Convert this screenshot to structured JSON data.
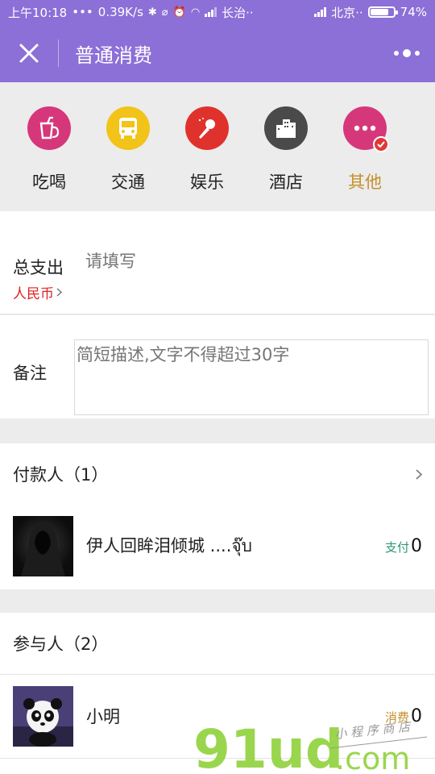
{
  "status_bar": {
    "time": "上午10:18",
    "dots": "•••",
    "speed": "0.39K/s",
    "carrier1": "长治··",
    "carrier2": "北京··",
    "battery": "74%",
    "battery_level": 0.74
  },
  "nav": {
    "title": "普通消费"
  },
  "categories": [
    {
      "label": "吃喝",
      "icon": "drink-icon",
      "color": "#d6377a"
    },
    {
      "label": "交通",
      "icon": "bus-icon",
      "color": "#f2c318"
    },
    {
      "label": "娱乐",
      "icon": "microphone-icon",
      "color": "#e0322c"
    },
    {
      "label": "酒店",
      "icon": "building-icon",
      "color": "#4a4a4a"
    },
    {
      "label": "其他",
      "icon": "more-dots-icon",
      "color": "#d6377a",
      "selected": true
    }
  ],
  "amount": {
    "label": "总支出",
    "currency": "人民币",
    "placeholder": "请填写"
  },
  "note": {
    "label": "备注",
    "placeholder": "简短描述,文字不得超过30字"
  },
  "payers": {
    "header": "付款人（1）",
    "items": [
      {
        "name": "伊人回眸泪倾城 ....จุ๊บ",
        "tag": "支付",
        "amount": "0"
      }
    ]
  },
  "participants": {
    "header": "参与人（2）",
    "items": [
      {
        "name": "小明",
        "tag": "消费",
        "amount": "0"
      }
    ]
  },
  "watermark": {
    "brand": "91ud",
    "domain": ".com",
    "slogan": "小 程 序 商 店"
  },
  "colors": {
    "nav_bg": "#8c6fd7",
    "currency_red": "#e02020",
    "selected_gold": "#c6902c",
    "pay_green": "#2a9a73",
    "watermark_green": "#8fd23a"
  }
}
